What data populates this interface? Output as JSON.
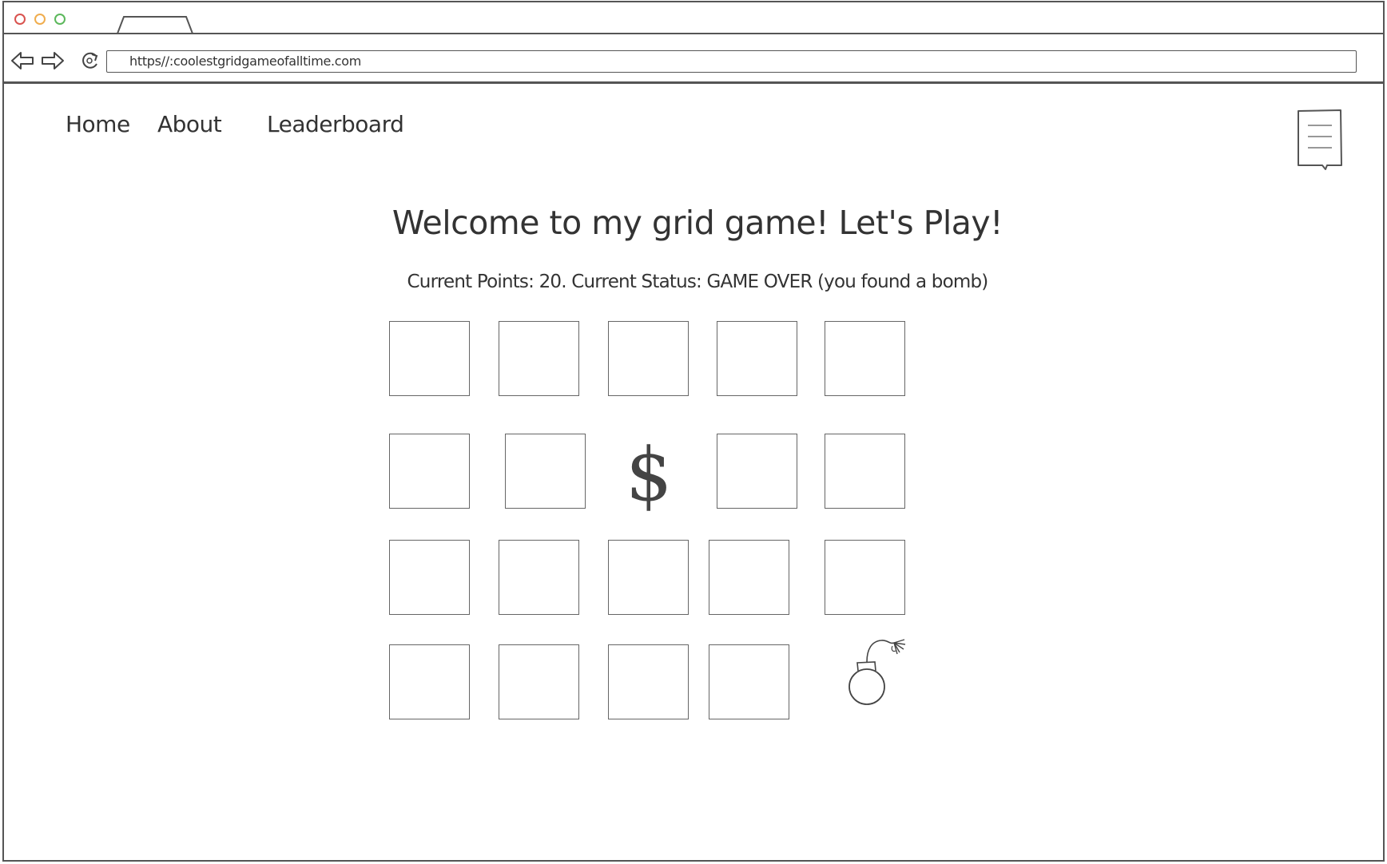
{
  "browser": {
    "url": "https//:coolestgridgameofalltime.com",
    "traffic_light_colors": [
      "#d9534f",
      "#f0ad4e",
      "#5cb85c"
    ]
  },
  "nav": {
    "items": [
      {
        "label": "Home"
      },
      {
        "label": "About"
      },
      {
        "label": "Leaderboard"
      }
    ]
  },
  "page": {
    "heading": "Welcome to my grid game! Let's Play!",
    "status_line": "Current Points: 20.  Current  Status: GAME OVER (you found a bomb)",
    "points": 20,
    "status": "GAME OVER"
  },
  "grid": {
    "rows": 4,
    "columns": 5,
    "revealed": [
      {
        "row": 2,
        "column": 3,
        "content": "$",
        "icon": "dollar-icon"
      },
      {
        "row": 4,
        "column": 5,
        "content": "bomb",
        "icon": "bomb-icon"
      }
    ]
  }
}
